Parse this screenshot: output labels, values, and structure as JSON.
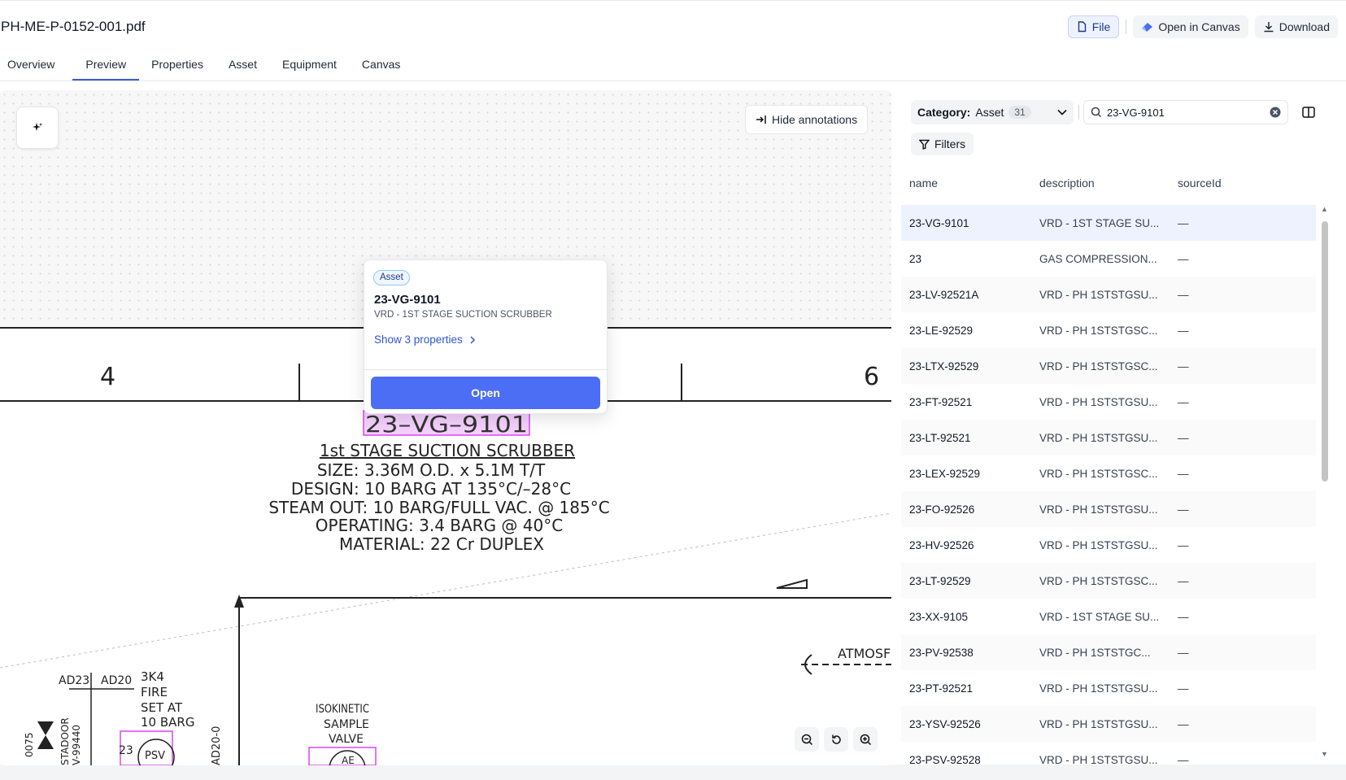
{
  "file": {
    "title": "PH-ME-P-0152-001.pdf"
  },
  "actions": {
    "file_label": "File",
    "canvas_label": "Open in Canvas",
    "download_label": "Download"
  },
  "tabs": [
    {
      "label": "Overview"
    },
    {
      "label": "Preview"
    },
    {
      "label": "Properties"
    },
    {
      "label": "Asset"
    },
    {
      "label": "Equipment"
    },
    {
      "label": "Canvas"
    }
  ],
  "active_tab": "Preview",
  "viewer": {
    "hide_annotations_label": "Hide annotations",
    "drawing": {
      "column_left": "4",
      "column_right": "6",
      "tag": "23–VG–9101",
      "heading": "1st STAGE SUCTION SCRUBBER",
      "lines": [
        "SIZE:  3.36M O.D. x 5.1M T/T",
        "DESIGN:  10 BARG AT 135°C/–28°C",
        "STEAM OUT:  10 BARG/FULL VAC. @ 185°C",
        "OPERATING:  3.4 BARG @ 40°C",
        "MATERIAL:   22 Cr DUPLEX"
      ],
      "bottom_labels": [
        "AD23",
        "AD20",
        "3K4",
        "FIRE",
        "SET AT",
        "10 BARG",
        "ISOKINETIC",
        "SAMPLE",
        "VALVE",
        "ATMOSF",
        "AD20-0",
        "0075",
        "STADOOR",
        "V-99440",
        "PSV",
        "23",
        "AE"
      ]
    }
  },
  "popover": {
    "chip": "Asset",
    "title": "23-VG-9101",
    "subtitle": "VRD - 1ST STAGE SUCTION SCRUBBER",
    "link": "Show 3 properties",
    "open_label": "Open"
  },
  "panel": {
    "category_label": "Category:",
    "category_value": "Asset",
    "category_count": "31",
    "search_value": "23-VG-9101",
    "filters_label": "Filters",
    "columns": [
      "name",
      "description",
      "sourceId"
    ],
    "rows": [
      {
        "name": "23-VG-9101",
        "description": "VRD - 1ST STAGE SU...",
        "sourceId": "—"
      },
      {
        "name": "23",
        "description": "GAS COMPRESSION...",
        "sourceId": "—"
      },
      {
        "name": "23-LV-92521A",
        "description": "VRD - PH 1STSTGSU...",
        "sourceId": "—"
      },
      {
        "name": "23-LE-92529",
        "description": "VRD - PH 1STSTGSC...",
        "sourceId": "—"
      },
      {
        "name": "23-LTX-92529",
        "description": "VRD - PH 1STSTGSC...",
        "sourceId": "—"
      },
      {
        "name": "23-FT-92521",
        "description": "VRD - PH 1STSTGSU...",
        "sourceId": "—"
      },
      {
        "name": "23-LT-92521",
        "description": "VRD - PH 1STSTGSU...",
        "sourceId": "—"
      },
      {
        "name": "23-LEX-92529",
        "description": "VRD - PH 1STSTGSC...",
        "sourceId": "—"
      },
      {
        "name": "23-FO-92526",
        "description": "VRD - PH 1STSTGSU...",
        "sourceId": "—"
      },
      {
        "name": "23-HV-92526",
        "description": "VRD - PH 1STSTGSU...",
        "sourceId": "—"
      },
      {
        "name": "23-LT-92529",
        "description": "VRD - PH 1STSTGSC...",
        "sourceId": "—"
      },
      {
        "name": "23-XX-9105",
        "description": "VRD - 1ST STAGE SU...",
        "sourceId": "—"
      },
      {
        "name": "23-PV-92538",
        "description": "VRD - PH 1STSTGC...",
        "sourceId": "—"
      },
      {
        "name": "23-PT-92521",
        "description": "VRD - PH 1STSTGSU...",
        "sourceId": "—"
      },
      {
        "name": "23-YSV-92526",
        "description": "VRD - PH 1STSTGSU...",
        "sourceId": "—"
      },
      {
        "name": "23-PSV-92528",
        "description": "VRD - PH 1STSTGSU...",
        "sourceId": "—"
      }
    ]
  },
  "colors": {
    "accent": "#4c6ef5",
    "highlight": "#d946ef",
    "chip_border": "#93c5fd"
  }
}
